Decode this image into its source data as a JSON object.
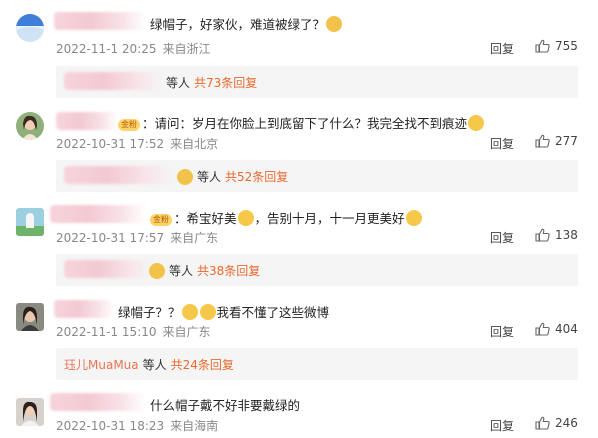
{
  "ui": {
    "reply_label": "回复"
  },
  "comments": [
    {
      "text": "绿帽子，好家伙，难道被绿了？",
      "time": "2022-11-1 20:25",
      "location": "来自浙江",
      "likes": "755",
      "sub_prefix": "等人",
      "sub_count": "共73条回复"
    },
    {
      "badge": "金粉",
      "text": "：请问：岁月在你脸上到底留下了什么？我完全找不到痕迹",
      "time": "2022-10-31 17:52",
      "location": "来自北京",
      "likes": "277",
      "sub_prefix": "等人",
      "sub_count": "共52条回复"
    },
    {
      "badge": "金粉",
      "text": "：希宝好美",
      "text2": "，告别十月，十一月更美好",
      "time": "2022-10-31 17:57",
      "location": "来自广东",
      "likes": "138",
      "sub_prefix": "等人",
      "sub_count": "共38条回复"
    },
    {
      "text": "绿帽子？？",
      "text2": "我看不懂了这些微博",
      "time": "2022-11-1 15:10",
      "location": "来自广东",
      "likes": "404",
      "sub_user": "珏儿MuaMua",
      "sub_prefix": "等人",
      "sub_count": "共24条回复"
    },
    {
      "text": "什么帽子戴不好非要戴绿的",
      "time": "2022-10-31 18:23",
      "location": "来自海南",
      "likes": "246"
    }
  ]
}
